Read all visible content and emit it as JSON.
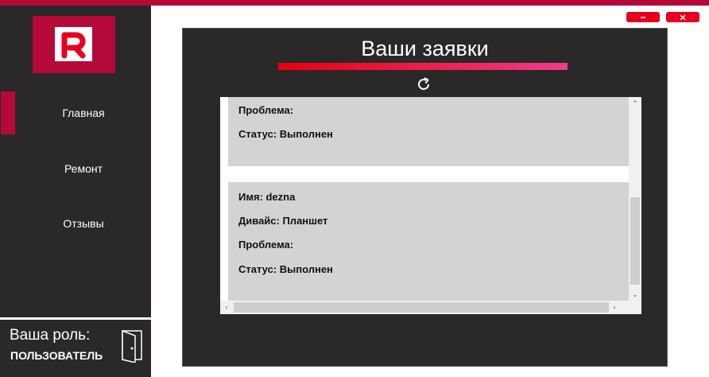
{
  "colors": {
    "accent": "#b5093a",
    "sidebar_bg": "#2a2829",
    "window_button": "#e5001f",
    "card_bg": "#d3d3d3",
    "gradient_start": "#e7000f",
    "gradient_end": "#f03c8a"
  },
  "sidebar": {
    "logo_icon": "logo-icon",
    "items": [
      {
        "label": "Главная",
        "active": true
      },
      {
        "label": "Ремонт",
        "active": false
      },
      {
        "label": "Отзывы",
        "active": false
      }
    ],
    "role_label": "Ваша роль:",
    "role_value": "ПОЛЬЗОВАТЕЛЬ",
    "exit_icon": "door-exit-icon"
  },
  "window_controls": {
    "minimize_icon": "minimize-icon",
    "close_icon": "close-icon"
  },
  "main": {
    "title": "Ваши заявки",
    "refresh_icon": "refresh-icon",
    "cards": [
      {
        "problem": "Проблема:",
        "status": "Статус: Выполнен"
      },
      {
        "name": "Имя: dezna",
        "device": "Дивайс: Планшет",
        "problem": "Проблема:",
        "status": "Статус: Выполнен"
      }
    ]
  }
}
